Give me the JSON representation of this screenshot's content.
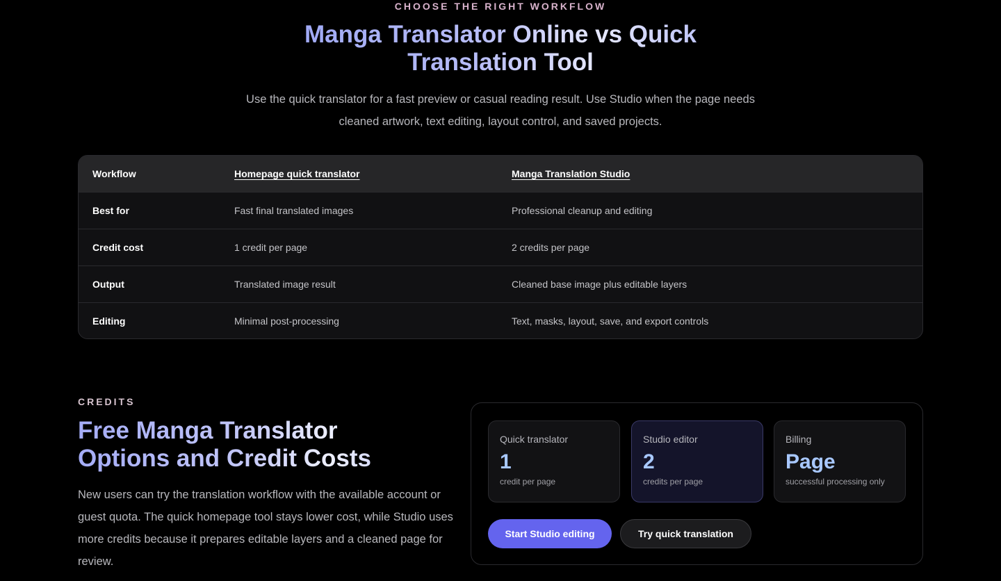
{
  "workflow_section": {
    "eyebrow": "CHOOSE THE RIGHT WORKFLOW",
    "title_line1": "Manga Translator Online vs Quick",
    "title_line2": "Translation Tool",
    "lead_line1": "Use the quick translator for a fast preview or casual reading result. Use Studio when the page needs",
    "lead_line2": "cleaned artwork, text editing, layout control, and saved projects."
  },
  "comparison_table": {
    "headers": [
      "Workflow",
      "Homepage quick translator",
      "Manga Translation Studio"
    ],
    "rows": [
      [
        "Best for",
        "Fast final translated images",
        "Professional cleanup and editing"
      ],
      [
        "Credit cost",
        "1 credit per page",
        "2 credits per page"
      ],
      [
        "Output",
        "Translated image result",
        "Cleaned base image plus editable layers"
      ],
      [
        "Editing",
        "Minimal post-processing",
        "Text, masks, layout, save, and export controls"
      ]
    ]
  },
  "credits_section": {
    "eyebrow": "CREDITS",
    "title_line1": "Free Manga Translator",
    "title_line2": "Options and Credit Costs",
    "lead": "New users can try the translation workflow with the available account or guest quota. The quick homepage tool stays lower cost, while Studio uses more credits because it prepares editable layers and a cleaned page for review.",
    "cards": [
      {
        "label": "Quick translator",
        "value": "1",
        "sub": "credit per page"
      },
      {
        "label": "Studio editor",
        "value": "2",
        "sub": "credits per page"
      },
      {
        "label": "Billing",
        "value": "Page",
        "sub": "successful processing only"
      }
    ],
    "primary_button": "Start Studio editing",
    "secondary_button": "Try quick translation"
  },
  "colors": {
    "background": "#000000",
    "accent_button": "#6464ee",
    "value_blue": "#a8c8ff",
    "eyebrow_pink": "#d9b3cc"
  }
}
